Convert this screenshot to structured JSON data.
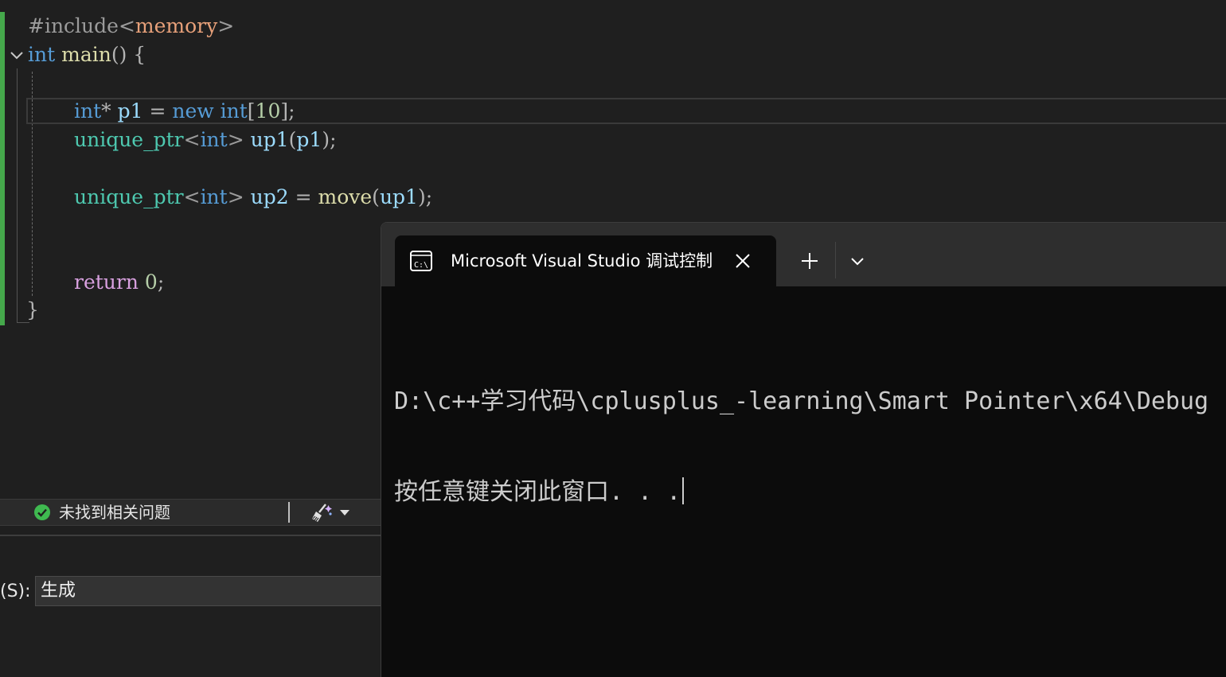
{
  "editor": {
    "lines": [
      {
        "segments": [
          {
            "t": "#include",
            "c": "pre"
          },
          {
            "t": "<",
            "c": "tpl"
          },
          {
            "t": "memory",
            "c": "inc"
          },
          {
            "t": ">",
            "c": "tpl"
          }
        ]
      },
      {
        "segments": [
          {
            "t": "int",
            "c": "kw"
          },
          {
            "t": " ",
            "c": "pun"
          },
          {
            "t": "main",
            "c": "fn"
          },
          {
            "t": "()",
            "c": "pun"
          },
          {
            "t": " {",
            "c": "pun"
          }
        ]
      },
      {
        "segments": [
          {
            "t": "int",
            "c": "kw"
          },
          {
            "t": "* ",
            "c": "pun"
          },
          {
            "t": "p1",
            "c": "var"
          },
          {
            "t": " = ",
            "c": "pun"
          },
          {
            "t": "new",
            "c": "kw"
          },
          {
            "t": " ",
            "c": "pun"
          },
          {
            "t": "int",
            "c": "kw"
          },
          {
            "t": "[",
            "c": "pun"
          },
          {
            "t": "10",
            "c": "num"
          },
          {
            "t": "];",
            "c": "pun"
          }
        ]
      },
      {
        "segments": [
          {
            "t": "unique_ptr",
            "c": "ty"
          },
          {
            "t": "<",
            "c": "tpl"
          },
          {
            "t": "int",
            "c": "kw"
          },
          {
            "t": ">",
            "c": "tpl"
          },
          {
            "t": " ",
            "c": "pun"
          },
          {
            "t": "up1",
            "c": "var"
          },
          {
            "t": "(",
            "c": "pun"
          },
          {
            "t": "p1",
            "c": "var"
          },
          {
            "t": ");",
            "c": "pun"
          }
        ]
      },
      {
        "segments": [
          {
            "t": "unique_ptr",
            "c": "ty"
          },
          {
            "t": "<",
            "c": "tpl"
          },
          {
            "t": "int",
            "c": "kw"
          },
          {
            "t": ">",
            "c": "tpl"
          },
          {
            "t": " ",
            "c": "pun"
          },
          {
            "t": "up2",
            "c": "var"
          },
          {
            "t": " = ",
            "c": "pun"
          },
          {
            "t": "move",
            "c": "fn"
          },
          {
            "t": "(",
            "c": "pun"
          },
          {
            "t": "up1",
            "c": "var"
          },
          {
            "t": ");",
            "c": "pun"
          }
        ]
      },
      {
        "segments": [
          {
            "t": "return",
            "c": "ctl"
          },
          {
            "t": " ",
            "c": "pun"
          },
          {
            "t": "0",
            "c": "num"
          },
          {
            "t": ";",
            "c": "pun"
          }
        ]
      },
      {
        "segments": [
          {
            "t": "}",
            "c": "pun"
          }
        ]
      }
    ]
  },
  "status": {
    "issues_text": "未找到相关问题"
  },
  "output": {
    "show_label": "(S):",
    "show_value": "生成"
  },
  "terminal": {
    "tab_title": "Microsoft Visual Studio 调试控制台",
    "lines": [
      "D:\\c++学习代码\\cplusplus_-learning\\Smart Pointer\\x64\\Debug",
      "按任意键关闭此窗口. . ."
    ]
  },
  "colors": {
    "editor_bg": "#1f1f1f",
    "terminal_bg": "#0c0c0c",
    "change_bar": "#45a84b",
    "status_ok": "#3fb950"
  }
}
